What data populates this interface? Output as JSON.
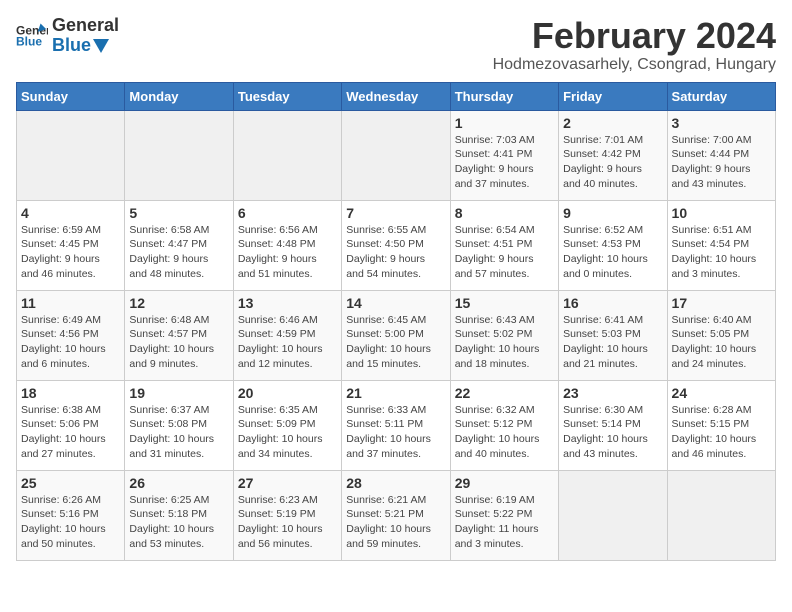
{
  "header": {
    "logo_general": "General",
    "logo_blue": "Blue",
    "title": "February 2024",
    "subtitle": "Hodmezovasarhely, Csongrad, Hungary"
  },
  "calendar": {
    "days_of_week": [
      "Sunday",
      "Monday",
      "Tuesday",
      "Wednesday",
      "Thursday",
      "Friday",
      "Saturday"
    ],
    "weeks": [
      [
        {
          "day": "",
          "info": "",
          "empty": true
        },
        {
          "day": "",
          "info": "",
          "empty": true
        },
        {
          "day": "",
          "info": "",
          "empty": true
        },
        {
          "day": "",
          "info": "",
          "empty": true
        },
        {
          "day": "1",
          "info": "Sunrise: 7:03 AM\nSunset: 4:41 PM\nDaylight: 9 hours\nand 37 minutes."
        },
        {
          "day": "2",
          "info": "Sunrise: 7:01 AM\nSunset: 4:42 PM\nDaylight: 9 hours\nand 40 minutes."
        },
        {
          "day": "3",
          "info": "Sunrise: 7:00 AM\nSunset: 4:44 PM\nDaylight: 9 hours\nand 43 minutes."
        }
      ],
      [
        {
          "day": "4",
          "info": "Sunrise: 6:59 AM\nSunset: 4:45 PM\nDaylight: 9 hours\nand 46 minutes."
        },
        {
          "day": "5",
          "info": "Sunrise: 6:58 AM\nSunset: 4:47 PM\nDaylight: 9 hours\nand 48 minutes."
        },
        {
          "day": "6",
          "info": "Sunrise: 6:56 AM\nSunset: 4:48 PM\nDaylight: 9 hours\nand 51 minutes."
        },
        {
          "day": "7",
          "info": "Sunrise: 6:55 AM\nSunset: 4:50 PM\nDaylight: 9 hours\nand 54 minutes."
        },
        {
          "day": "8",
          "info": "Sunrise: 6:54 AM\nSunset: 4:51 PM\nDaylight: 9 hours\nand 57 minutes."
        },
        {
          "day": "9",
          "info": "Sunrise: 6:52 AM\nSunset: 4:53 PM\nDaylight: 10 hours\nand 0 minutes."
        },
        {
          "day": "10",
          "info": "Sunrise: 6:51 AM\nSunset: 4:54 PM\nDaylight: 10 hours\nand 3 minutes."
        }
      ],
      [
        {
          "day": "11",
          "info": "Sunrise: 6:49 AM\nSunset: 4:56 PM\nDaylight: 10 hours\nand 6 minutes."
        },
        {
          "day": "12",
          "info": "Sunrise: 6:48 AM\nSunset: 4:57 PM\nDaylight: 10 hours\nand 9 minutes."
        },
        {
          "day": "13",
          "info": "Sunrise: 6:46 AM\nSunset: 4:59 PM\nDaylight: 10 hours\nand 12 minutes."
        },
        {
          "day": "14",
          "info": "Sunrise: 6:45 AM\nSunset: 5:00 PM\nDaylight: 10 hours\nand 15 minutes."
        },
        {
          "day": "15",
          "info": "Sunrise: 6:43 AM\nSunset: 5:02 PM\nDaylight: 10 hours\nand 18 minutes."
        },
        {
          "day": "16",
          "info": "Sunrise: 6:41 AM\nSunset: 5:03 PM\nDaylight: 10 hours\nand 21 minutes."
        },
        {
          "day": "17",
          "info": "Sunrise: 6:40 AM\nSunset: 5:05 PM\nDaylight: 10 hours\nand 24 minutes."
        }
      ],
      [
        {
          "day": "18",
          "info": "Sunrise: 6:38 AM\nSunset: 5:06 PM\nDaylight: 10 hours\nand 27 minutes."
        },
        {
          "day": "19",
          "info": "Sunrise: 6:37 AM\nSunset: 5:08 PM\nDaylight: 10 hours\nand 31 minutes."
        },
        {
          "day": "20",
          "info": "Sunrise: 6:35 AM\nSunset: 5:09 PM\nDaylight: 10 hours\nand 34 minutes."
        },
        {
          "day": "21",
          "info": "Sunrise: 6:33 AM\nSunset: 5:11 PM\nDaylight: 10 hours\nand 37 minutes."
        },
        {
          "day": "22",
          "info": "Sunrise: 6:32 AM\nSunset: 5:12 PM\nDaylight: 10 hours\nand 40 minutes."
        },
        {
          "day": "23",
          "info": "Sunrise: 6:30 AM\nSunset: 5:14 PM\nDaylight: 10 hours\nand 43 minutes."
        },
        {
          "day": "24",
          "info": "Sunrise: 6:28 AM\nSunset: 5:15 PM\nDaylight: 10 hours\nand 46 minutes."
        }
      ],
      [
        {
          "day": "25",
          "info": "Sunrise: 6:26 AM\nSunset: 5:16 PM\nDaylight: 10 hours\nand 50 minutes."
        },
        {
          "day": "26",
          "info": "Sunrise: 6:25 AM\nSunset: 5:18 PM\nDaylight: 10 hours\nand 53 minutes."
        },
        {
          "day": "27",
          "info": "Sunrise: 6:23 AM\nSunset: 5:19 PM\nDaylight: 10 hours\nand 56 minutes."
        },
        {
          "day": "28",
          "info": "Sunrise: 6:21 AM\nSunset: 5:21 PM\nDaylight: 10 hours\nand 59 minutes."
        },
        {
          "day": "29",
          "info": "Sunrise: 6:19 AM\nSunset: 5:22 PM\nDaylight: 11 hours\nand 3 minutes."
        },
        {
          "day": "",
          "info": "",
          "empty": true
        },
        {
          "day": "",
          "info": "",
          "empty": true
        }
      ]
    ]
  }
}
